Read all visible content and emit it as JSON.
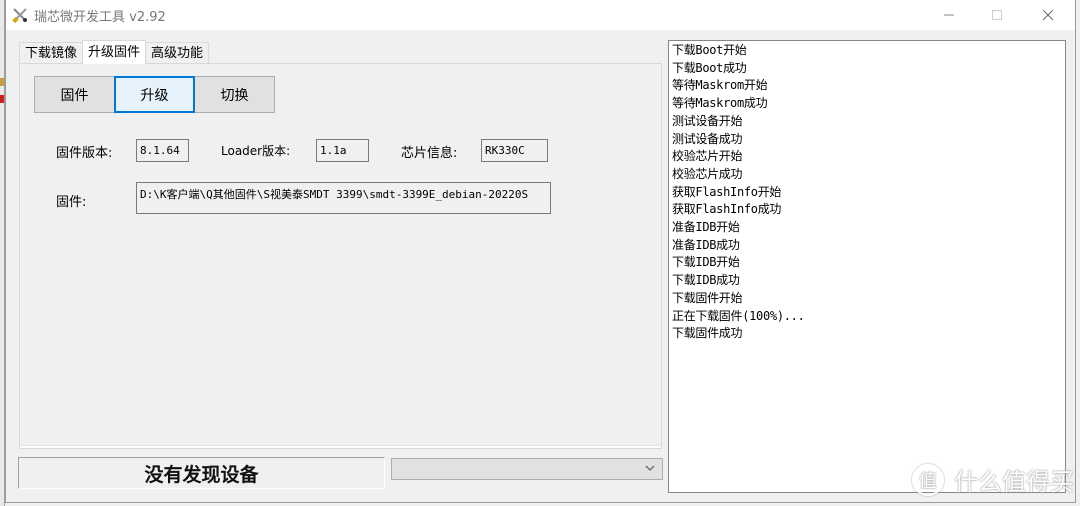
{
  "window": {
    "title": "瑞芯微开发工具 v2.92",
    "icon": "tools-icon",
    "controls": {
      "minimize": "minimize-icon",
      "maximize": "maximize-icon",
      "close": "close-icon"
    }
  },
  "tabs": [
    {
      "label": "下载镜像",
      "active": false
    },
    {
      "label": "升级固件",
      "active": true
    },
    {
      "label": "高级功能",
      "active": false
    }
  ],
  "upgrade_panel": {
    "buttons": [
      {
        "label": "固件",
        "focused": false
      },
      {
        "label": "升级",
        "focused": true
      },
      {
        "label": "切换",
        "focused": false
      }
    ],
    "firmware_version_label": "固件版本:",
    "firmware_version": "8.1.64",
    "loader_version_label": "Loader版本:",
    "loader_version": "1.1a",
    "chip_info_label": "芯片信息:",
    "chip_info": "RK330C",
    "firmware_label": "固件:",
    "firmware_path": "D:\\K客户端\\Q其他固件\\S视美泰SMDT 3399\\smdt-3399E_debian-20220S"
  },
  "status": {
    "device_status": "没有发现设备",
    "device_select_value": ""
  },
  "log": {
    "lines": [
      "下载Boot开始",
      "下载Boot成功",
      "等待Maskrom开始",
      "等待Maskrom成功",
      "测试设备开始",
      "测试设备成功",
      "校验芯片开始",
      "校验芯片成功",
      "获取FlashInfo开始",
      "获取FlashInfo成功",
      "准备IDB开始",
      "准备IDB成功",
      "下载IDB开始",
      "下载IDB成功",
      "下载固件开始",
      "正在下载固件(100%)...",
      "下载固件成功"
    ]
  },
  "watermark": {
    "badge": "值",
    "text": "什么值得买"
  },
  "colors": {
    "focus_border": "#0078d7",
    "window_bg": "#f0f0f0"
  }
}
